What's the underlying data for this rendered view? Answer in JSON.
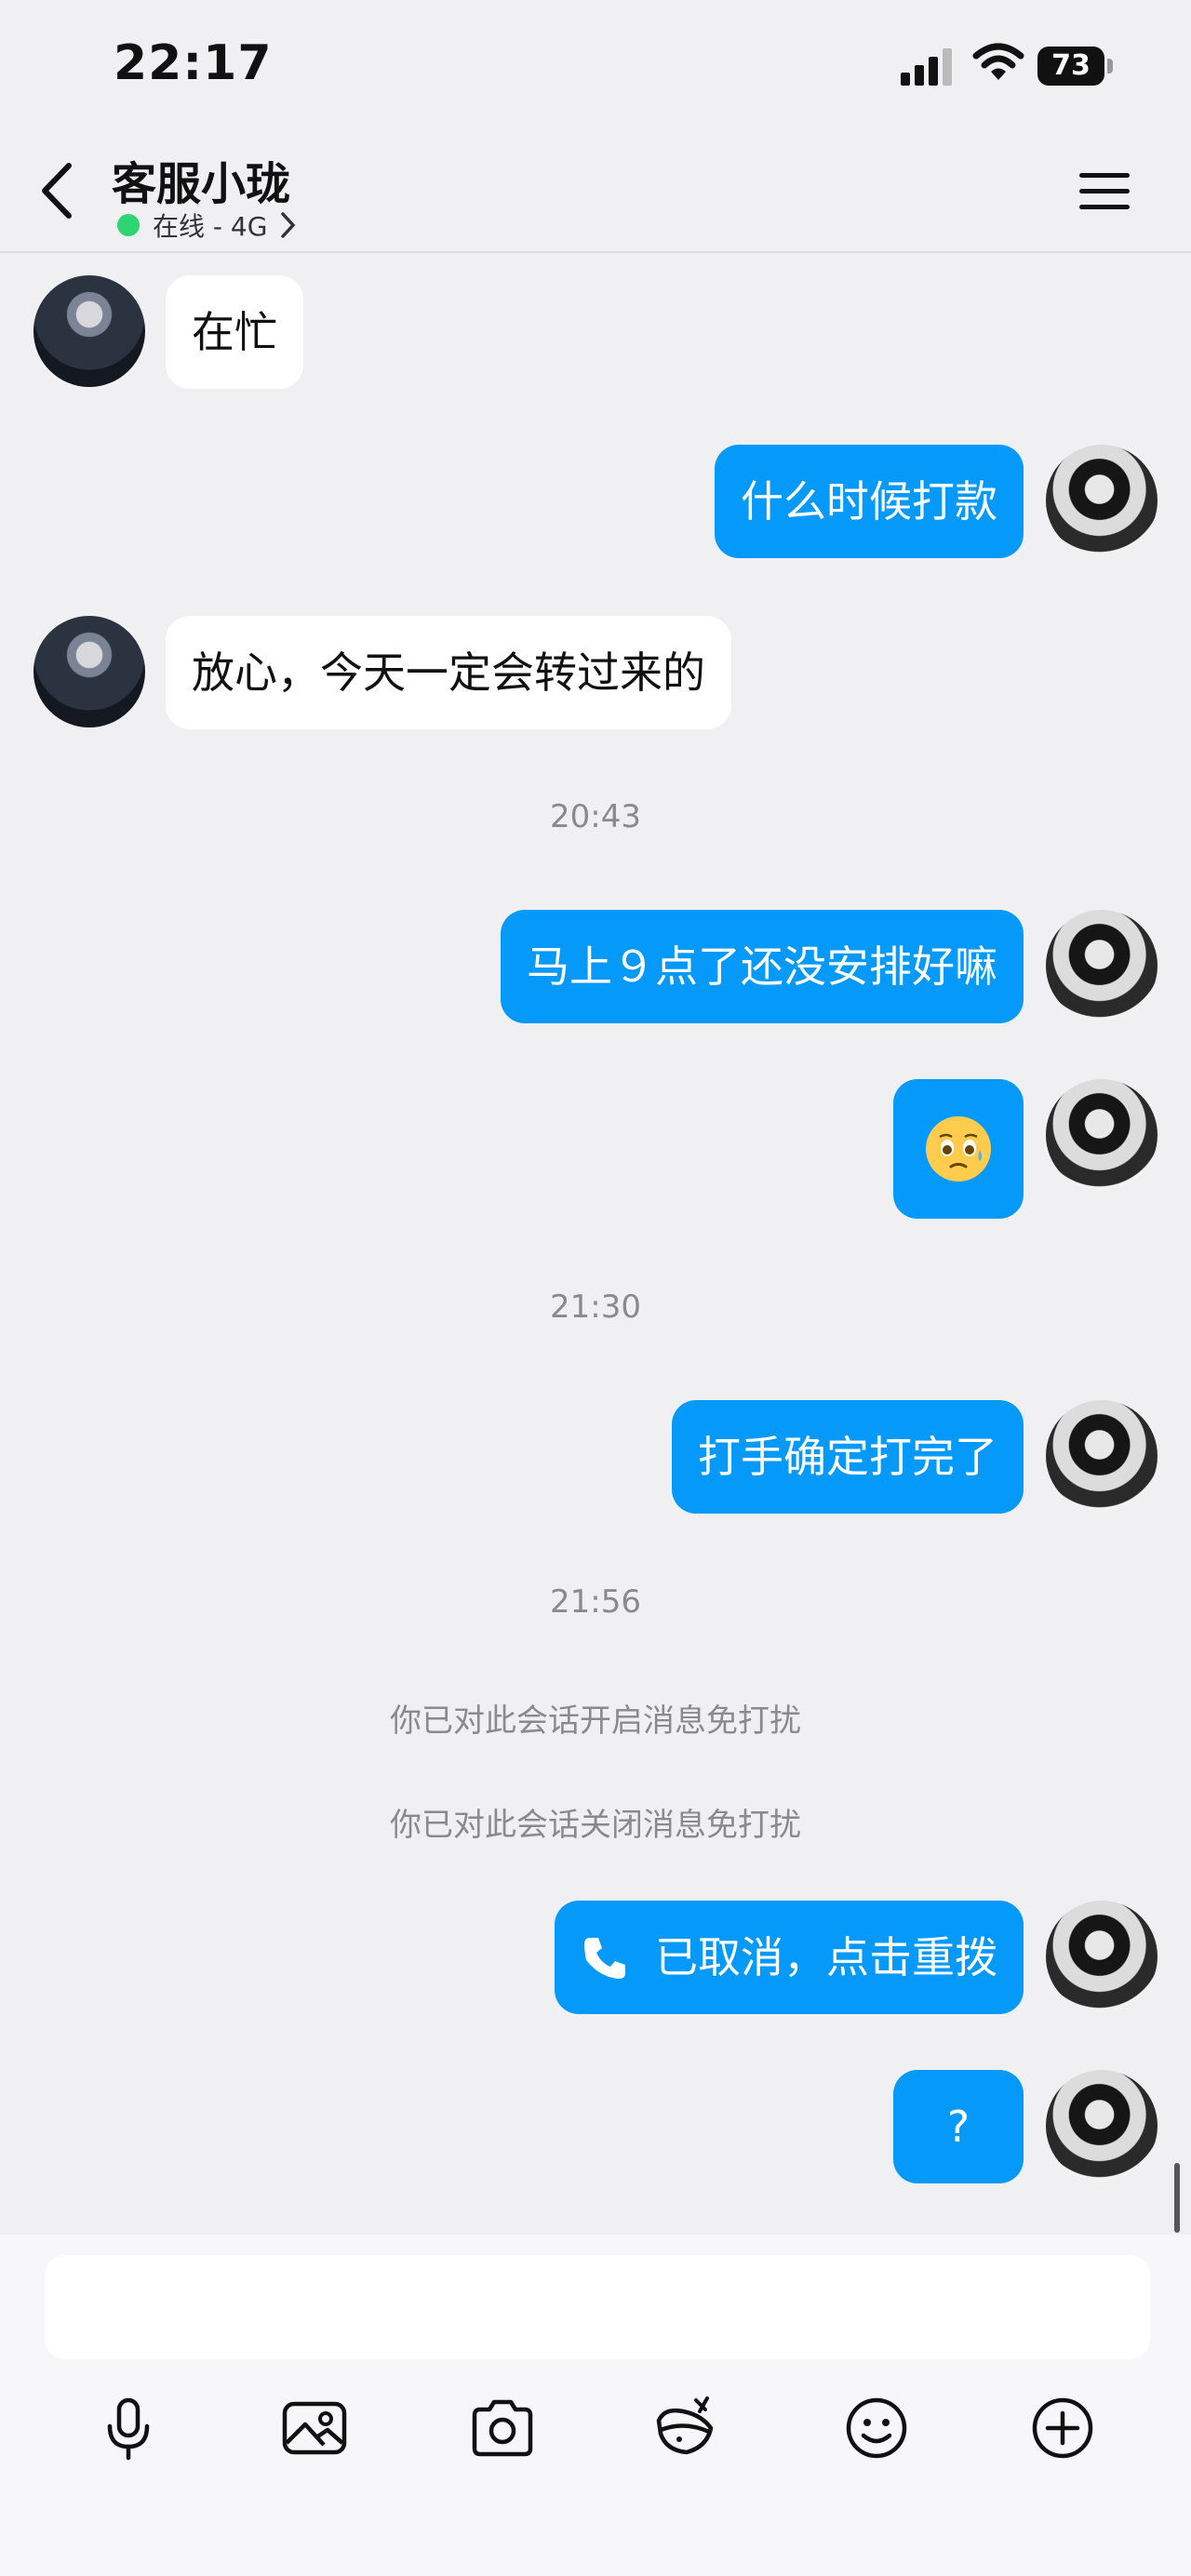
{
  "status_bar": {
    "time": "22:17",
    "battery": "73"
  },
  "header": {
    "contact_name": "客服小珑",
    "status": "在线 - 4G"
  },
  "messages": [
    {
      "side": "left",
      "text": "在忙"
    },
    {
      "side": "right",
      "text": "什么时候打款"
    },
    {
      "side": "left",
      "text": "放心，今天一定会转过来的"
    },
    {
      "timestamp": "20:43"
    },
    {
      "side": "right",
      "text": "马上９点了还没安排好嘛"
    },
    {
      "side": "right",
      "emoji": "worried-face-emoji"
    },
    {
      "timestamp": "21:30"
    },
    {
      "side": "right",
      "text": "打手确定打完了"
    },
    {
      "timestamp": "21:56"
    },
    {
      "system": "你已对此会话开启消息免打扰"
    },
    {
      "system": "你已对此会话关闭消息免打扰"
    },
    {
      "side": "right",
      "call_text": "已取消，点击重拨"
    },
    {
      "side": "right",
      "text": "?"
    }
  ],
  "input": {
    "placeholder": ""
  },
  "toolbar": [
    "microphone-icon",
    "image-icon",
    "camera-icon",
    "red-packet-icon",
    "emoji-icon",
    "plus-icon"
  ],
  "colors": {
    "accent": "#0599f9",
    "online": "#2ed573",
    "background": "#f0f0f2"
  }
}
